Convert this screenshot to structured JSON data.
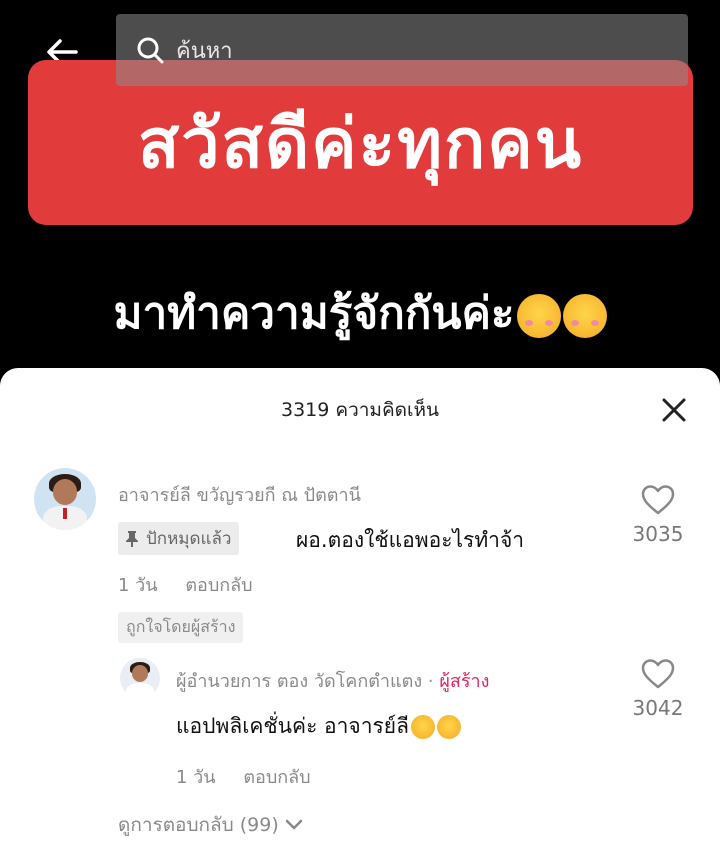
{
  "search": {
    "placeholder": "ค้นหา"
  },
  "video": {
    "banner_text": "สวัสดีค่ะทุกคน",
    "subtitle_text": "มาทำความรู้จักกันค่ะ",
    "banner_color": "#e23b3b"
  },
  "sheet": {
    "title": "3319 ความคิดเห็น",
    "comments": [
      {
        "author": "อาจารย์ลี ขวัญรวยกี ณ ปัตตานี",
        "pinned_label": "ปักหมุดแล้ว",
        "text": "ผอ.ตองใช้แอพอะไรทำจ้า",
        "time": "1 วัน",
        "reply_label": "ตอบกลับ",
        "liked_by_creator": "ถูกใจโดยผู้สร้าง",
        "likes": "3035"
      },
      {
        "author": "ผู้อำนวยการ ตอง วัดโคกตำแตง",
        "separator": "·",
        "creator_tag": "ผู้สร้าง",
        "text": "แอปพลิเคชั่นค่ะ อาจารย์ลี",
        "time": "1 วัน",
        "reply_label": "ตอบกลับ",
        "likes": "3042"
      }
    ],
    "view_replies": "ดูการตอบกลับ (99)"
  },
  "colors": {
    "creator_tag": "#e0245e",
    "sheet_bg": "#ffffff"
  },
  "icons": [
    "back-arrow-icon",
    "search-icon",
    "close-icon",
    "pin-icon",
    "heart-icon",
    "chevron-down-icon"
  ]
}
